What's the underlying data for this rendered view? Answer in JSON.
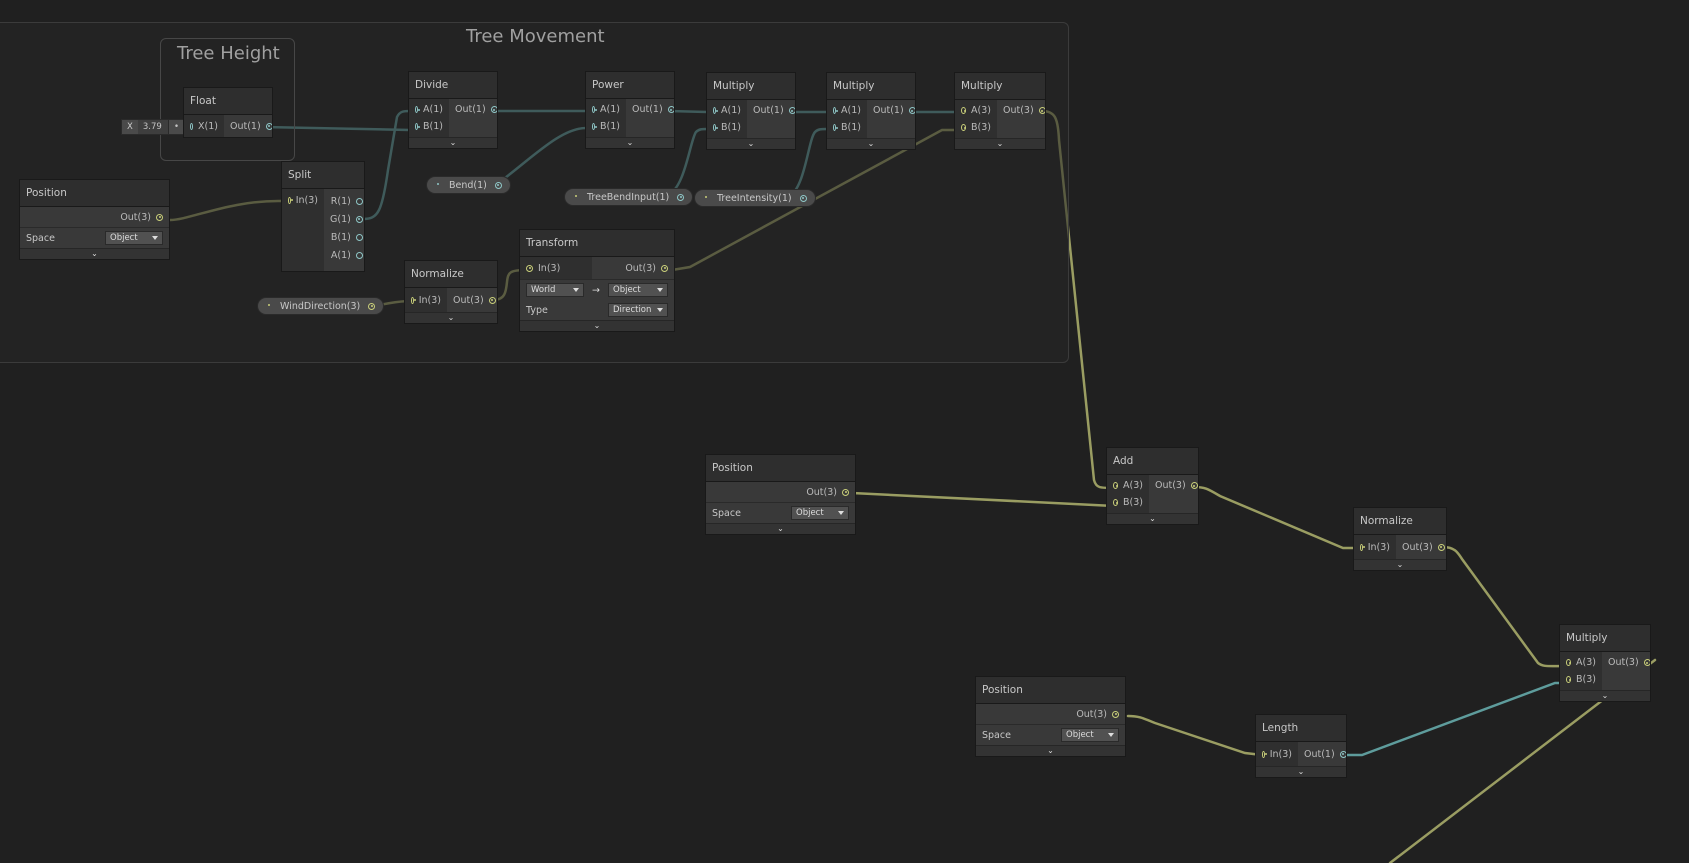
{
  "groups": {
    "tree_movement": "Tree Movement",
    "tree_height": "Tree Height"
  },
  "nodes": {
    "float": {
      "title": "Float",
      "in": "X(1)",
      "out": "Out(1)",
      "inline_label": "X",
      "inline_value": "3.79"
    },
    "position1": {
      "title": "Position",
      "out": "Out(3)",
      "space_label": "Space",
      "space_value": "Object"
    },
    "split": {
      "title": "Split",
      "in": "In(3)",
      "outs": [
        "R(1)",
        "G(1)",
        "B(1)",
        "A(1)"
      ]
    },
    "divide": {
      "title": "Divide",
      "ins": [
        "A(1)",
        "B(1)"
      ],
      "out": "Out(1)"
    },
    "power": {
      "title": "Power",
      "ins": [
        "A(1)",
        "B(1)"
      ],
      "out": "Out(1)"
    },
    "multiply1": {
      "title": "Multiply",
      "ins": [
        "A(1)",
        "B(1)"
      ],
      "out": "Out(1)"
    },
    "multiply2": {
      "title": "Multiply",
      "ins": [
        "A(1)",
        "B(1)"
      ],
      "out": "Out(1)"
    },
    "multiply3": {
      "title": "Multiply",
      "ins": [
        "A(3)",
        "B(3)"
      ],
      "out": "Out(3)"
    },
    "normalize1": {
      "title": "Normalize",
      "in": "In(3)",
      "out": "Out(3)"
    },
    "transform": {
      "title": "Transform",
      "in": "In(3)",
      "out": "Out(3)",
      "from": "World",
      "arrow": "→",
      "to": "Object",
      "type_label": "Type",
      "type_value": "Direction"
    },
    "position2": {
      "title": "Position",
      "out": "Out(3)",
      "space_label": "Space",
      "space_value": "Object"
    },
    "add": {
      "title": "Add",
      "ins": [
        "A(3)",
        "B(3)"
      ],
      "out": "Out(3)"
    },
    "normalize2": {
      "title": "Normalize",
      "in": "In(3)",
      "out": "Out(3)"
    },
    "multiply4": {
      "title": "Multiply",
      "ins": [
        "A(3)",
        "B(3)"
      ],
      "out": "Out(3)"
    },
    "position3": {
      "title": "Position",
      "out": "Out(3)",
      "space_label": "Space",
      "space_value": "Object"
    },
    "length": {
      "title": "Length",
      "in": "In(3)",
      "out": "Out(1)"
    }
  },
  "properties": {
    "bend": "Bend(1)",
    "tree_bend_input": "TreeBendInput(1)",
    "tree_intensity": "TreeIntensity(1)",
    "wind_direction": "WindDirection(3)"
  },
  "footer_glyph": "⌄",
  "colors": {
    "float_wire": "#5e9c9c",
    "vector_wire": "#9a9d62",
    "background": "#202020"
  }
}
